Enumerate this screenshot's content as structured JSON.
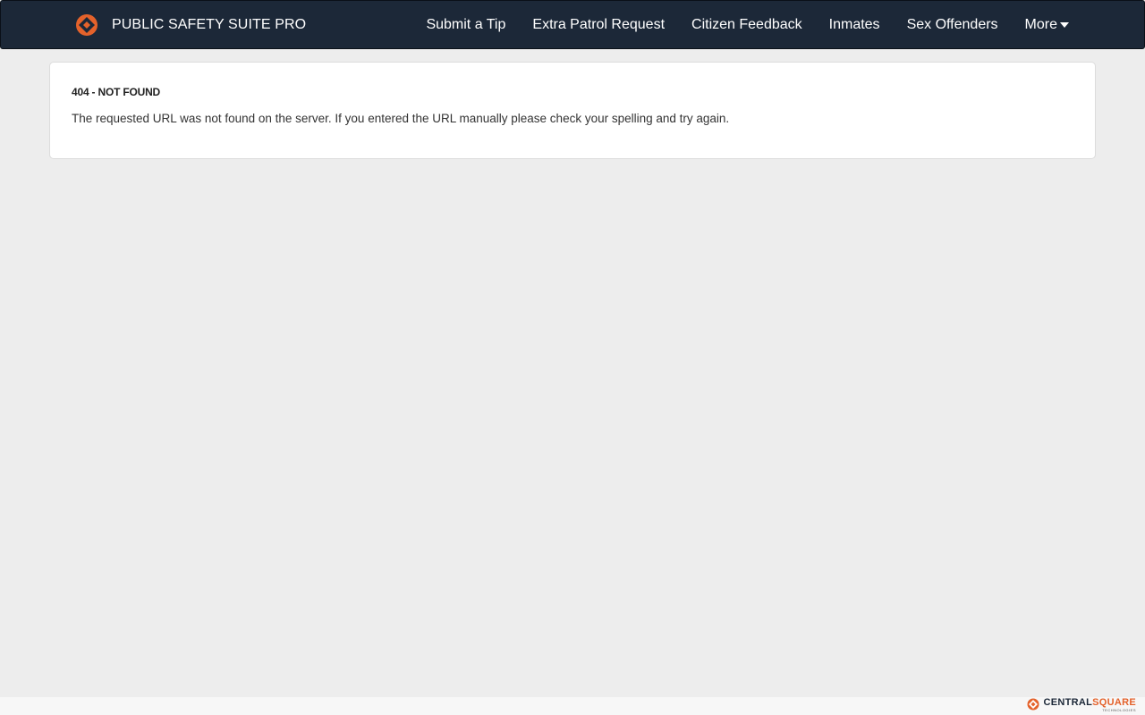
{
  "navbar": {
    "brand_title": "PUBLIC SAFETY SUITE PRO",
    "logo_icon": "diamond-logo-icon",
    "links": [
      {
        "label": "Submit a Tip"
      },
      {
        "label": "Extra Patrol Request"
      },
      {
        "label": "Citizen Feedback"
      },
      {
        "label": "Inmates"
      },
      {
        "label": "Sex Offenders"
      },
      {
        "label": "More",
        "icon": "caret-down-icon"
      }
    ]
  },
  "error": {
    "title": "404 - NOT FOUND",
    "message": "The requested URL was not found on the server. If you entered the URL manually please check your spelling and try again."
  },
  "footer": {
    "brand_part1": "CENTRAL",
    "brand_part2": "SQUARE",
    "brand_sub": "TECHNOLOGIES"
  },
  "colors": {
    "navbar_bg": "#1c2838",
    "accent_orange": "#e4622b",
    "page_bg": "#ededed"
  }
}
